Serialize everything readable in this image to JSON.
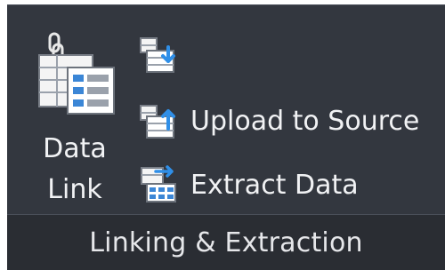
{
  "ribbon": {
    "panel_title": "Linking & Extraction",
    "data_link": {
      "label_line1": "Data",
      "label_line2": "Link",
      "icon": "data-link-icon"
    },
    "commands": [
      {
        "label": "",
        "icon": "download-from-source-icon"
      },
      {
        "label": "Upload to Source",
        "icon": "upload-to-source-icon"
      },
      {
        "label": "Extract  Data",
        "icon": "extract-data-icon"
      }
    ],
    "colors": {
      "panel_bg": "#33373f",
      "footer_bg": "#2a2d33",
      "text": "#f1f2f4",
      "accent_blue": "#2f8fe8"
    }
  }
}
